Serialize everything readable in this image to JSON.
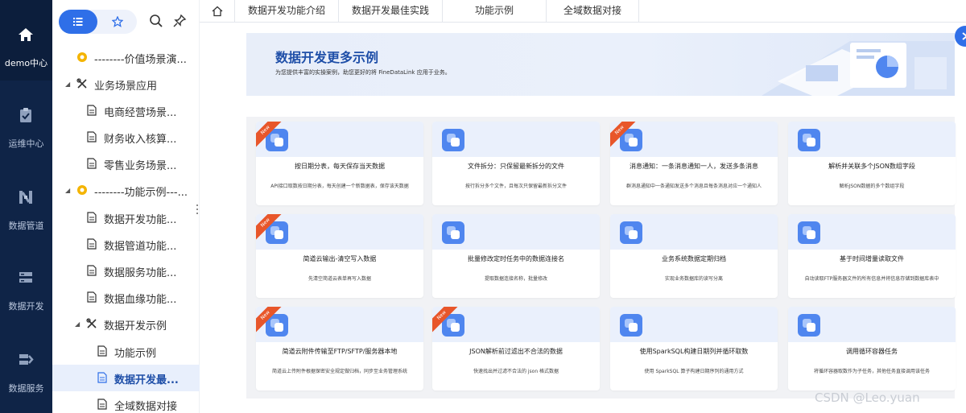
{
  "leftnav": {
    "items": [
      {
        "label": "demo中心",
        "icon": "home-icon"
      },
      {
        "label": "运维中心",
        "icon": "clipboard-check-icon"
      },
      {
        "label": "数据管道",
        "icon": "pipeline-icon"
      },
      {
        "label": "数据开发",
        "icon": "data-dev-icon"
      },
      {
        "label": "数据服务",
        "icon": "data-service-icon"
      }
    ]
  },
  "tree": {
    "items": [
      {
        "label": "--------价值场景演..."
      },
      {
        "label": "业务场景应用"
      },
      {
        "label": "电商经营场景..."
      },
      {
        "label": "财务收入核算..."
      },
      {
        "label": "零售业务场景..."
      },
      {
        "label": "--------功能示例---..."
      },
      {
        "label": "数据开发功能..."
      },
      {
        "label": "数据管道功能..."
      },
      {
        "label": "数据服务功能..."
      },
      {
        "label": "数据血缘功能..."
      },
      {
        "label": "数据开发示例"
      },
      {
        "label": "功能示例"
      },
      {
        "label": "数据开发最..."
      },
      {
        "label": "全域数据对接"
      }
    ]
  },
  "tabs": [
    "数据开发功能介绍",
    "数据开发最佳实践",
    "功能示例",
    "全域数据对接"
  ],
  "banner": {
    "title": "数据开发更多示例",
    "subtitle": "为您提供丰富的实操案例，助您更好的将 FineDataLink 应用于业务。"
  },
  "cards": [
    {
      "title": "按日期分表，每天保存当天数据",
      "desc": "API接口取数按日期分表，每天创建一个新数据表，保存该天数据",
      "new": true
    },
    {
      "title": "文件拆分：只保留最新拆分的文件",
      "desc": "按行拆分多个文件，且每次只保留最新拆分文件",
      "new": false
    },
    {
      "title": "消息通知：一条消息通知一人，发送多条消息",
      "desc": "群消息通知中一条通知发送多个消息且每条消息对应一个通知人",
      "new": true
    },
    {
      "title": "解析并关联多个JSON数组字段",
      "desc": "解析JSON数据的多个数组字段",
      "new": false
    },
    {
      "title": "简道云输出-清空写入数据",
      "desc": "先清空简道云表单再写入数据",
      "new": true
    },
    {
      "title": "批量修改定时任务中的数据连接名",
      "desc": "提取数据连接名称，批量修改",
      "new": false
    },
    {
      "title": "业务系统数据定期归档",
      "desc": "实现业务数据库的读写分离",
      "new": false
    },
    {
      "title": "基于时间增量读取文件",
      "desc": "自动读取FTP服务器文件的所有信息并将信息存储到数据库表中",
      "new": false
    },
    {
      "title": "简道云附件传输至FTP/SFTP/服务器本地",
      "desc": "简道云上传附件根据保密安全规定做归档，同步至业务管理系统",
      "new": true
    },
    {
      "title": "JSON解析前过滤出不合法的数据",
      "desc": "快速找出并过滤不合法的 json 格式数据",
      "new": true
    },
    {
      "title": "使用SparkSQL构建日期列并循环取数",
      "desc": "使用 SparkSQL 算子构建日期序列的通用方式",
      "new": false
    },
    {
      "title": "调用循环容器任务",
      "desc": "将循环容器取数作为子任务，其他任务直接调用该任务",
      "new": false
    }
  ],
  "new_badge": "New",
  "watermark": "CSDN @Leo.yuan",
  "colors": {
    "nav_bg": "#0f2447",
    "accent": "#2f6fe8",
    "badge": "#e8562a"
  }
}
